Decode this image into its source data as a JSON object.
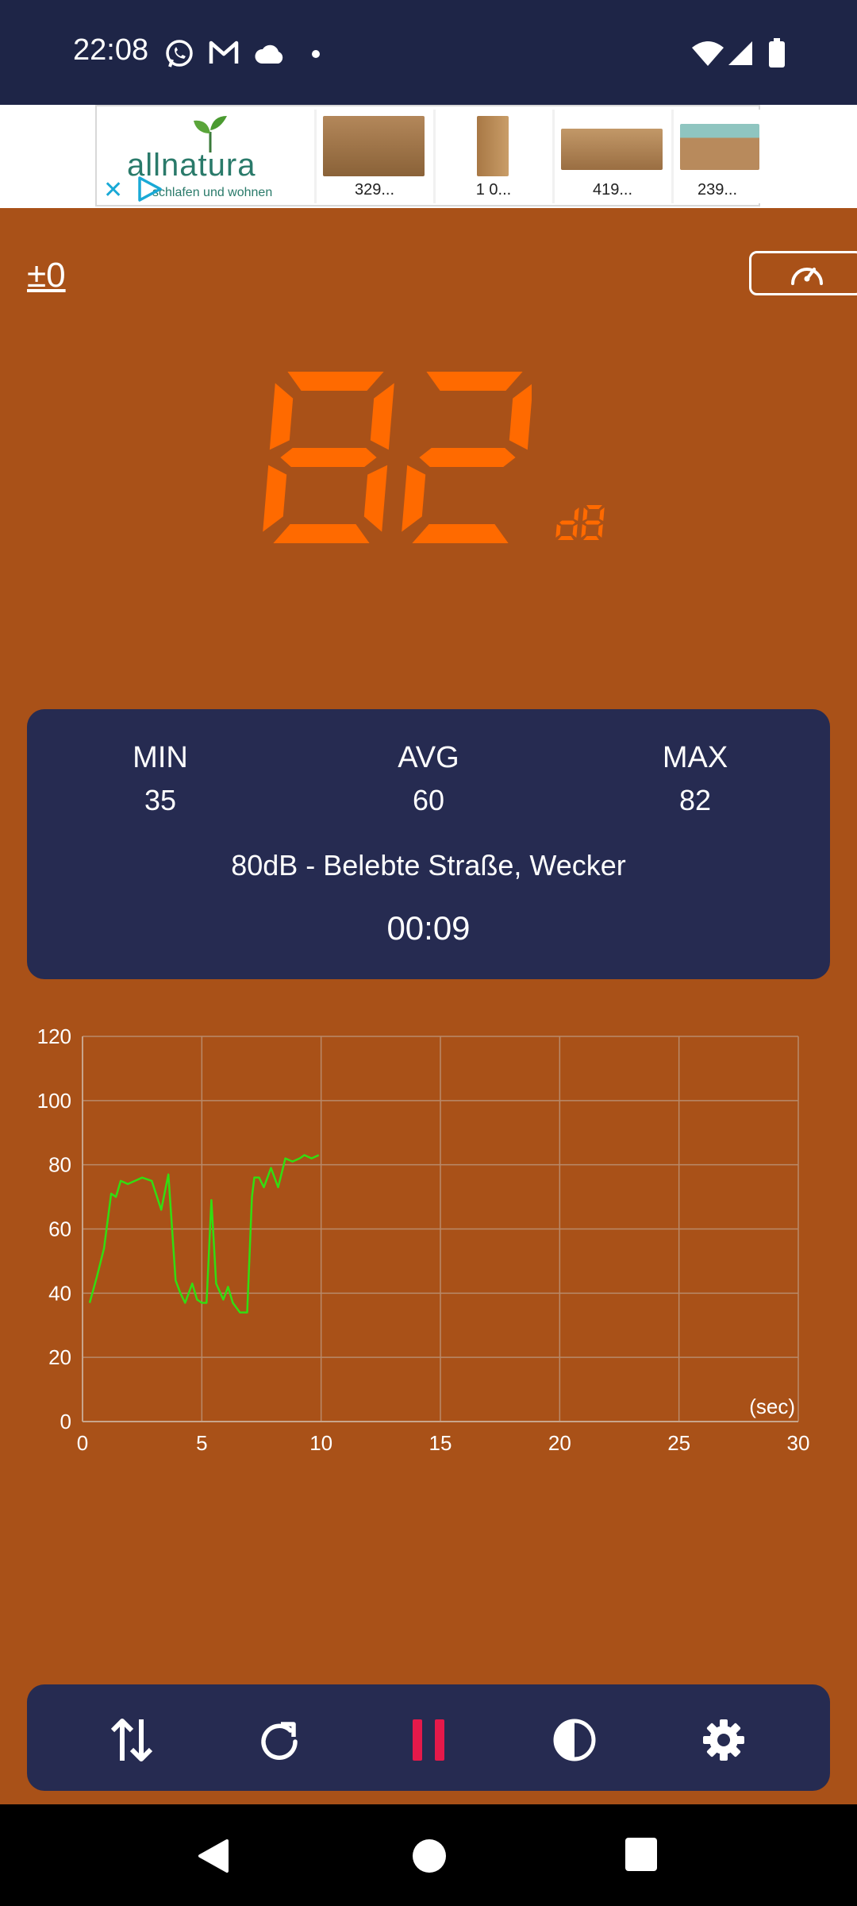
{
  "status_bar": {
    "time": "22:08",
    "notification_icons": [
      "whatsapp-icon",
      "gmail-icon",
      "cloud-icon",
      "dot-icon"
    ],
    "system_icons": [
      "wifi-icon",
      "signal-icon",
      "battery-icon"
    ]
  },
  "ad": {
    "brand": "allnatura",
    "tagline": "schlafen und wohnen",
    "products": [
      {
        "price": "329..."
      },
      {
        "price": "1 0..."
      },
      {
        "price": "419..."
      },
      {
        "price": "239..."
      }
    ]
  },
  "meter": {
    "offset_label": "±0",
    "current_value": "82",
    "unit": "dB"
  },
  "stats": {
    "min_label": "MIN",
    "min_value": "35",
    "avg_label": "AVG",
    "avg_value": "60",
    "max_label": "MAX",
    "max_value": "82",
    "description": "80dB - Belebte Straße, Wecker",
    "elapsed": "00:09"
  },
  "chart_data": {
    "type": "line",
    "xlabel": "(sec)",
    "ylabel": "",
    "xlim": [
      0,
      30
    ],
    "ylim": [
      0,
      120
    ],
    "x_ticks": [
      0,
      5,
      10,
      15,
      20,
      25,
      30
    ],
    "y_ticks": [
      0,
      20,
      40,
      60,
      80,
      100,
      120
    ],
    "grid": true,
    "line_color": "#33DD11",
    "series": [
      {
        "x": [
          0.3,
          0.6,
          0.9,
          1.2,
          1.4,
          1.6,
          1.9,
          2.2,
          2.5,
          2.9,
          3.3,
          3.6,
          3.9,
          4.1,
          4.3,
          4.6,
          4.8,
          5.0,
          5.2,
          5.4,
          5.6,
          5.9,
          6.1,
          6.3,
          6.6,
          6.9,
          7.1,
          7.2,
          7.4,
          7.6,
          7.9,
          8.2,
          8.5,
          8.8,
          9.1,
          9.3,
          9.6,
          9.9
        ],
        "y": [
          37,
          45,
          54,
          71,
          70,
          75,
          74,
          75,
          76,
          75,
          66,
          77,
          44,
          40,
          37,
          43,
          38,
          37,
          37,
          69,
          43,
          38,
          42,
          37,
          34,
          34,
          70,
          76,
          76,
          73,
          79,
          73,
          82,
          81,
          82,
          83,
          82,
          83
        ]
      }
    ]
  },
  "toolbar": {
    "buttons": [
      "sort-icon",
      "reset-icon",
      "pause-icon",
      "theme-icon",
      "settings-icon"
    ]
  },
  "colors": {
    "background": "#A95118",
    "panel": "#262B51",
    "status_bar": "#1E2547",
    "digit": "#FF6A00",
    "pause": "#E5194A",
    "chart_line": "#33DD11"
  }
}
